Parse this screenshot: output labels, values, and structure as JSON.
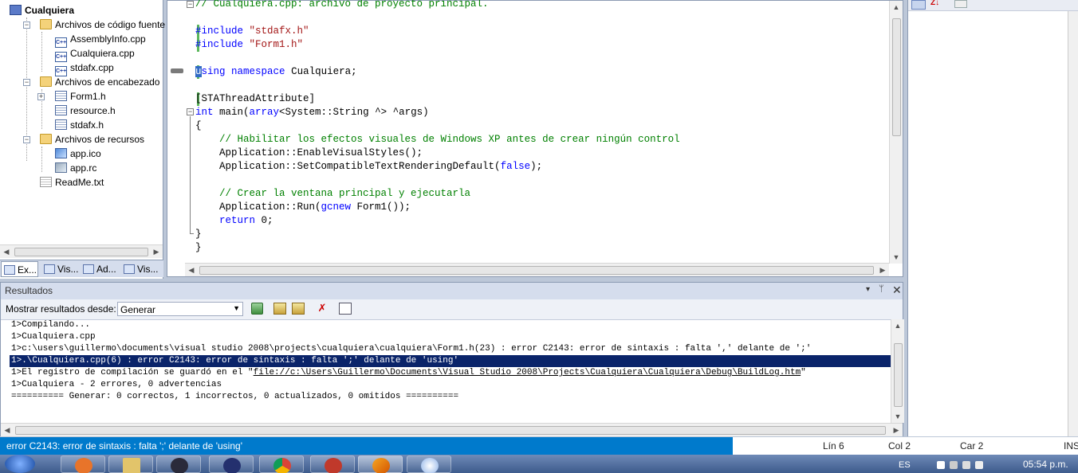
{
  "solution_explorer": {
    "project": "Cualquiera",
    "items": [
      {
        "label": "Archivos de código fuente",
        "kind": "folder"
      },
      {
        "label": "AssemblyInfo.cpp",
        "kind": "cpp"
      },
      {
        "label": "Cualquiera.cpp",
        "kind": "cpp"
      },
      {
        "label": "stdafx.cpp",
        "kind": "cpp"
      },
      {
        "label": "Archivos de encabezado",
        "kind": "folder"
      },
      {
        "label": "Form1.h",
        "kind": "h"
      },
      {
        "label": "resource.h",
        "kind": "h"
      },
      {
        "label": "stdafx.h",
        "kind": "h"
      },
      {
        "label": "Archivos de recursos",
        "kind": "folder"
      },
      {
        "label": "app.ico",
        "kind": "ico"
      },
      {
        "label": "app.rc",
        "kind": "rc"
      },
      {
        "label": "ReadMe.txt",
        "kind": "txt"
      }
    ],
    "tabs": [
      "Ex...",
      "Vis...",
      "Ad...",
      "Vis..."
    ]
  },
  "editor": {
    "lines": [
      "// Cualquiera.cpp: archivo de proyecto principal.",
      "",
      "#include \"stdafx.h\"",
      "#include \"Form1.h\"",
      "",
      "using namespace Cualquiera;",
      "",
      "[STAThreadAttribute]",
      "int main(array<System::String ^> ^args)",
      "{",
      "    // Habilitar los efectos visuales de Windows XP antes de crear ningún control",
      "    Application::EnableVisualStyles();",
      "    Application::SetCompatibleTextRenderingDefault(false);",
      "",
      "    // Crear la ventana principal y ejecutarla",
      "    Application::Run(gcnew Form1());",
      "    return 0;",
      "}",
      "}"
    ]
  },
  "output": {
    "title": "Resultados",
    "show_from_label": "Mostrar resultados desde:",
    "show_from_value": "Generar",
    "lines": [
      "1>Compilando...",
      "1>Cualquiera.cpp",
      "1>c:\\users\\guillermo\\documents\\visual studio 2008\\projects\\cualquiera\\cualquiera\\Form1.h(23) : error C2143: error de sintaxis : falta ',' delante de ';'",
      "1>.\\Cualquiera.cpp(6) : error C2143: error de sintaxis : falta ';' delante de 'using'",
      "1>El registro de compilación se guardó en el \"",
      "1>Cualquiera - 2 errores, 0 advertencias",
      "========== Generar: 0 correctos, 1 incorrectos, 0 actualizados, 0 omitidos =========="
    ],
    "log_link": "file://c:\\Users\\Guillermo\\Documents\\Visual Studio 2008\\Projects\\Cualquiera\\Cualquiera\\Debug\\BuildLog.htm",
    "log_suffix": "\"",
    "selected_line": 3
  },
  "status": {
    "message": "error C2143: error de sintaxis : falta ';' delante de 'using'",
    "line": "Lín 6",
    "col": "Col 2",
    "car": "Car 2",
    "ins": "INS"
  },
  "taskbar": {
    "lang": "ES",
    "time": "05:54 p.m."
  }
}
